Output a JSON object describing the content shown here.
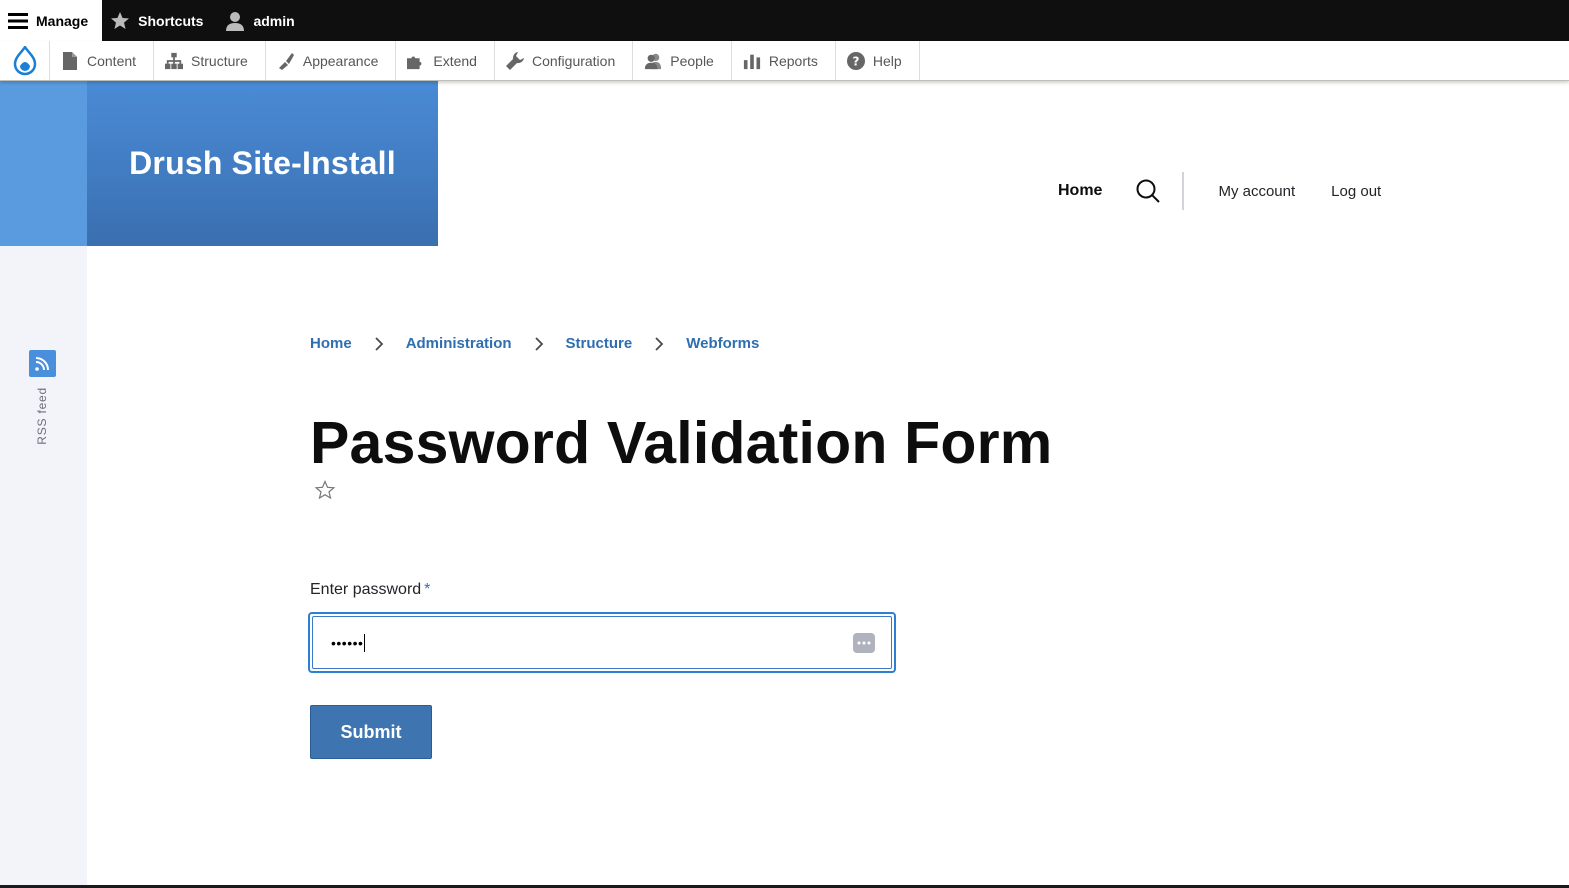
{
  "toolbar": {
    "manage_label": "Manage",
    "shortcuts_label": "Shortcuts",
    "user_label": "admin"
  },
  "tray": {
    "items": [
      {
        "label": "Content",
        "icon": "document-icon"
      },
      {
        "label": "Structure",
        "icon": "structure-icon"
      },
      {
        "label": "Appearance",
        "icon": "paintbrush-icon"
      },
      {
        "label": "Extend",
        "icon": "puzzle-icon"
      },
      {
        "label": "Configuration",
        "icon": "wrench-icon"
      },
      {
        "label": "People",
        "icon": "people-icon"
      },
      {
        "label": "Reports",
        "icon": "bar-chart-icon"
      },
      {
        "label": "Help",
        "icon": "help-icon"
      }
    ]
  },
  "site": {
    "name": "Drush Site-Install"
  },
  "main_nav": {
    "home": "Home",
    "my_account": "My account",
    "log_out": "Log out"
  },
  "rss": {
    "label": "RSS feed"
  },
  "breadcrumb": [
    "Home",
    "Administration",
    "Structure",
    "Webforms"
  ],
  "page": {
    "title": "Password Validation Form"
  },
  "form": {
    "password_label": "Enter password",
    "required_marker": "*",
    "password_value": "••••••",
    "submit_label": "Submit"
  },
  "colors": {
    "toolbar_bg": "#0f0f0f",
    "brand_blue": "#3a6fb0",
    "link_blue": "#2f6fb0",
    "button_blue": "#3e74b0",
    "focus_blue": "#2b7fd4"
  }
}
